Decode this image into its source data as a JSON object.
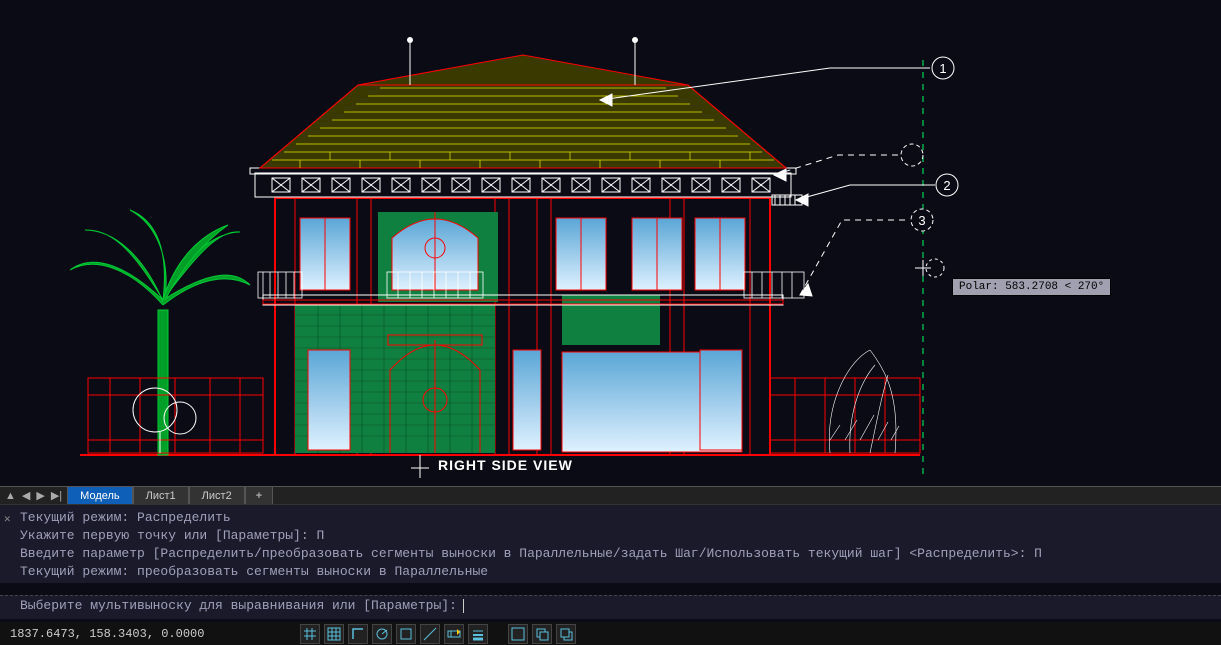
{
  "drawing": {
    "view_label": "RIGHT SIDE VIEW",
    "callouts": {
      "c1": "1",
      "c2": "2",
      "c3": "3"
    },
    "polar_tooltip": "Polar: 583.2708 < 270°"
  },
  "tabs": {
    "model": "Модель",
    "sheet1": "Лист1",
    "sheet2": "Лист2",
    "add": "+"
  },
  "command_history": {
    "l1": "Текущий режим: Распределить",
    "l2": "Укажите первую точку или [Параметры]: П",
    "l3": "Введите параметр [Распределить/преобразовать сегменты выноски в Параллельные/задать Шаг/Использовать текущий шаг] <Распределить>: П",
    "l4": "Текущий режим: преобразовать сегменты выноски в Параллельные"
  },
  "command_prompt": "Выберите мультивыноску для выравнивания или [Параметры]:",
  "status": {
    "coords": "1837.6473, 158.3403, 0.0000"
  }
}
